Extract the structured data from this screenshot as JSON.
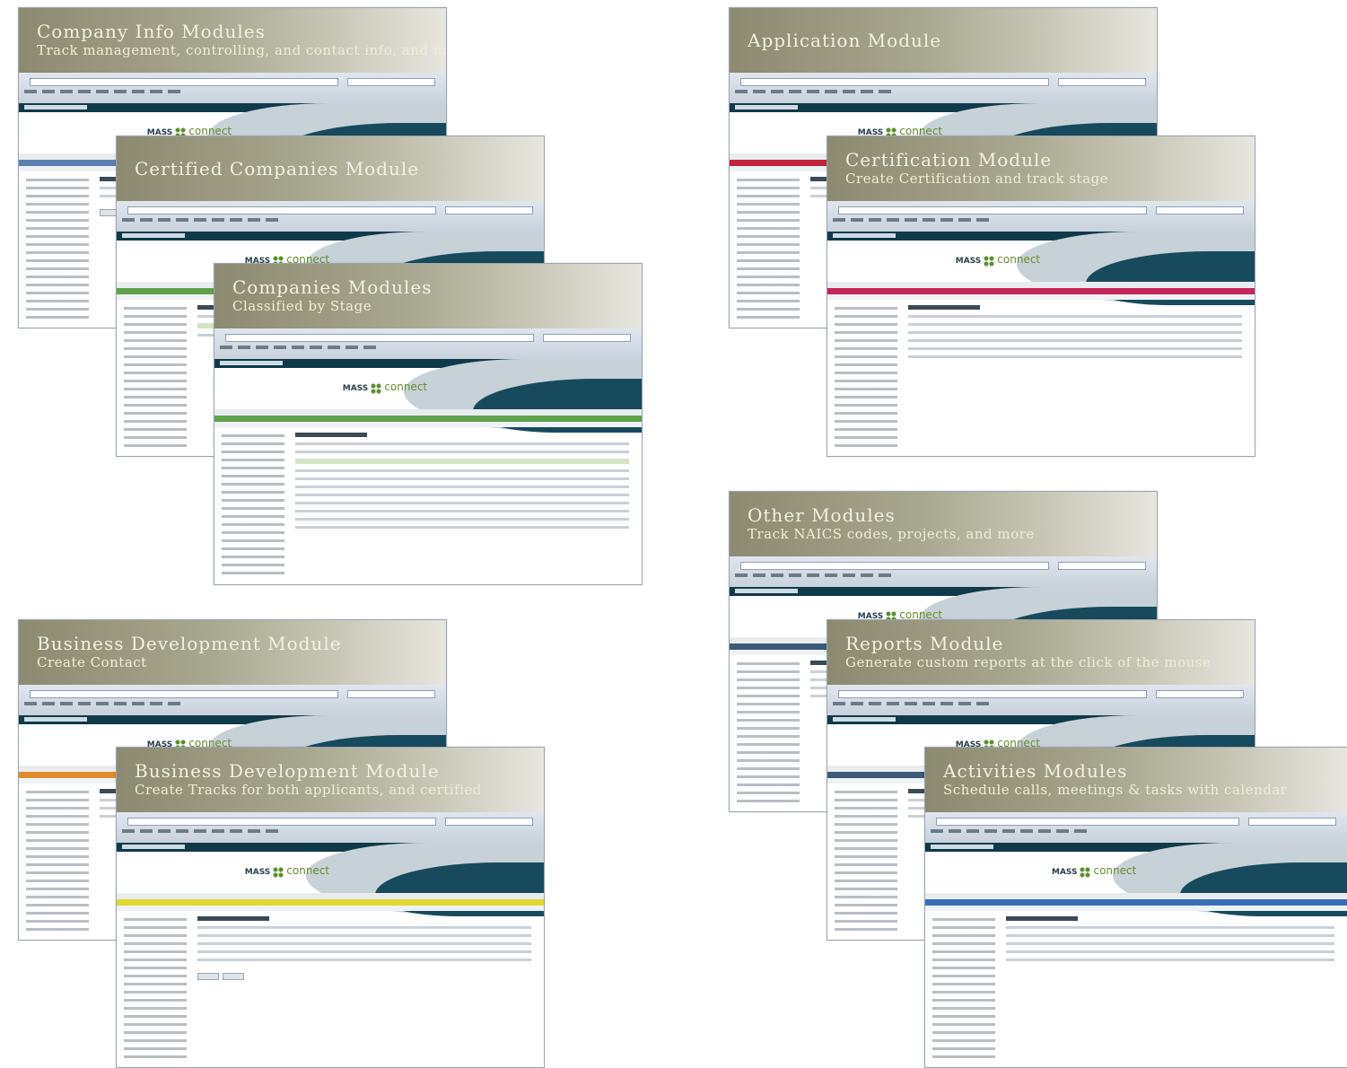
{
  "brand": {
    "logo_text": "MASS",
    "logo_suffix": "connect"
  },
  "cards": [
    {
      "id": "company-info",
      "title": "Company Info Modules",
      "subtitle": "Track management, controlling, and contact info, and more",
      "accent": "#5b7fb0"
    },
    {
      "id": "certified-companies",
      "title": "Certified Companies Module",
      "subtitle": "",
      "accent": "#5fa24a"
    },
    {
      "id": "companies-stage",
      "title": "Companies Modules",
      "subtitle": "Classified by Stage",
      "accent": "#5fa24a"
    },
    {
      "id": "business-dev-contact",
      "title": "Business Development Module",
      "subtitle": "Create Contact",
      "accent": "#e08a2a"
    },
    {
      "id": "business-dev-tracks",
      "title": "Business Development Module",
      "subtitle": "Create Tracks for both applicants, and certified",
      "accent": "#e0d830"
    },
    {
      "id": "application",
      "title": "Application Module",
      "subtitle": "",
      "accent": "#c2243a"
    },
    {
      "id": "certification",
      "title": "Certification Module",
      "subtitle": "Create Certification and track stage",
      "accent": "#c4265a"
    },
    {
      "id": "other",
      "title": "Other Modules",
      "subtitle": "Track NAICS codes, projects, and more",
      "accent": "#3b5a78"
    },
    {
      "id": "reports",
      "title": "Reports Module",
      "subtitle": "Generate custom reports at the click of the mouse",
      "accent": "#3b5a78"
    },
    {
      "id": "activities",
      "title": "Activities Modules",
      "subtitle": "Schedule calls, meetings & tasks with calendar",
      "accent": "#3a6fb5"
    }
  ]
}
